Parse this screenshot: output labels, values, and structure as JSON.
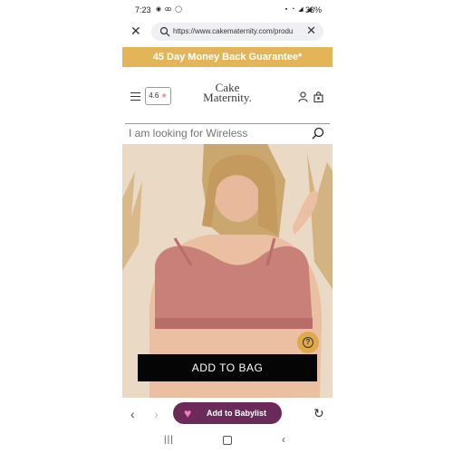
{
  "status_bar": {
    "time": "7:23",
    "left_icons": "◉ ꝏ ◯",
    "right_icons": "▪ ◔ ◢ ◢",
    "battery": "33%"
  },
  "browser": {
    "url": "https://www.cakematernity.com/produ"
  },
  "banner": {
    "text": "45 Day Money Back Guarantee*"
  },
  "header": {
    "rating": "4.6",
    "logo_line1": "Cake",
    "logo_line2": "Maternity."
  },
  "search": {
    "placeholder": "I am looking for Wireless"
  },
  "product": {
    "add_to_bag_label": "ADD TO BAG",
    "help_glyph": "?"
  },
  "bottom_nav": {
    "babylist_label": "Add to Babylist"
  },
  "colors": {
    "banner": "#e3b558",
    "babylist": "#6b2a5a",
    "cta": "#050505",
    "bra": "#c98079"
  }
}
